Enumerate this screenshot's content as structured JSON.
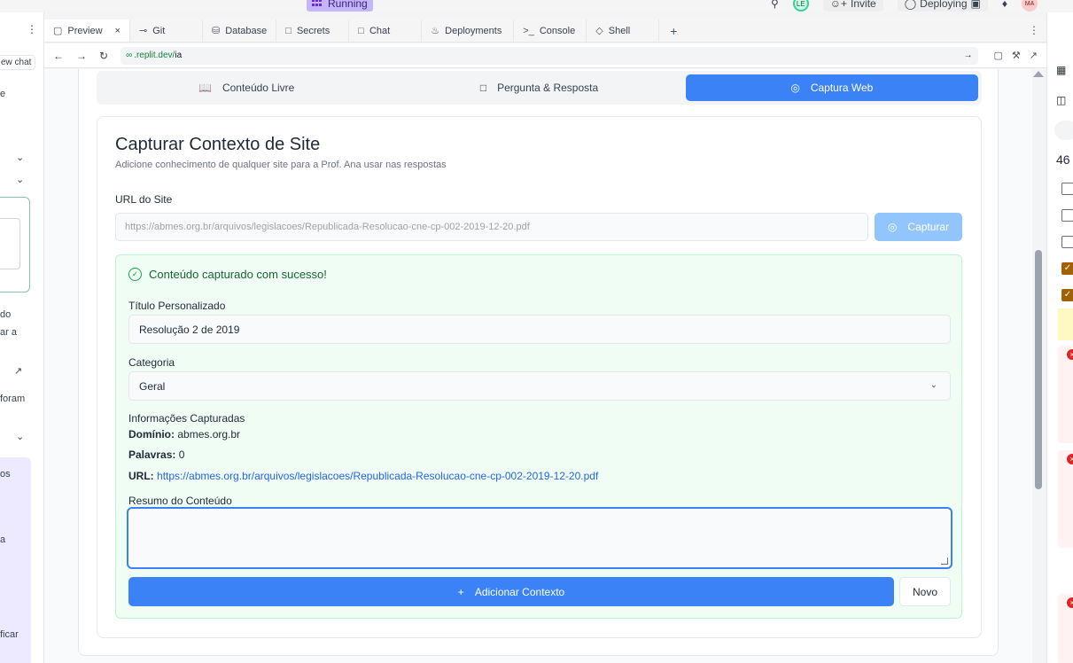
{
  "topbar": {
    "running_label": "Running",
    "invite_label": "Invite",
    "deploying_label": "Deploying",
    "avatar_le": "LE",
    "avatar_ma": "MA"
  },
  "left_panel": {
    "new_chat_label": "ew chat",
    "fragments": [
      "e",
      "do",
      "ar a",
      "foram",
      "os",
      "a",
      "ficar"
    ]
  },
  "tabs": [
    {
      "label": "Preview",
      "icon": "monitor-icon",
      "active": true
    },
    {
      "label": "Git",
      "icon": "git-icon"
    },
    {
      "label": "Database",
      "icon": "database-icon"
    },
    {
      "label": "Secrets",
      "icon": "lock-icon"
    },
    {
      "label": "Chat",
      "icon": "chat-icon"
    },
    {
      "label": "Deployments",
      "icon": "deploy-icon"
    },
    {
      "label": "Console",
      "icon": "terminal-icon"
    },
    {
      "label": "Shell",
      "icon": "shell-icon"
    }
  ],
  "urlbar": {
    "domain": ".replit.dev/",
    "path": "ia"
  },
  "right_panel": {
    "number": "46"
  },
  "segments": [
    {
      "label": "Conteúdo Livre",
      "icon": "book-icon",
      "active": false
    },
    {
      "label": "Pergunta & Resposta",
      "icon": "message-icon",
      "active": false
    },
    {
      "label": "Captura Web",
      "icon": "globe-icon",
      "active": true
    }
  ],
  "card": {
    "title": "Capturar Contexto de Site",
    "subtitle": "Adicione conhecimento de qualquer site para a Prof. Ana usar nas respostas",
    "url_label": "URL do Site",
    "url_value": "https://abmes.org.br/arquivos/legislacoes/Republicada-Resolucao-cne-cp-002-2019-12-20.pdf",
    "capture_button": "Capturar"
  },
  "success": {
    "heading": "Conteúdo capturado com sucesso!",
    "title_label": "Título Personalizado",
    "title_value": "Resolução 2 de 2019",
    "category_label": "Categoria",
    "category_value": "Geral",
    "info_heading": "Informações Capturadas",
    "domain_label": "Domínio:",
    "domain_value": "abmes.org.br",
    "words_label": "Palavras:",
    "words_value": "0",
    "url_label": "URL:",
    "url_value": "https://abmes.org.br/arquivos/legislacoes/Republicada-Resolucao-cne-cp-002-2019-12-20.pdf",
    "summary_label": "Resumo do Conteúdo",
    "add_button": "Adicionar Contexto",
    "new_button": "Novo"
  }
}
